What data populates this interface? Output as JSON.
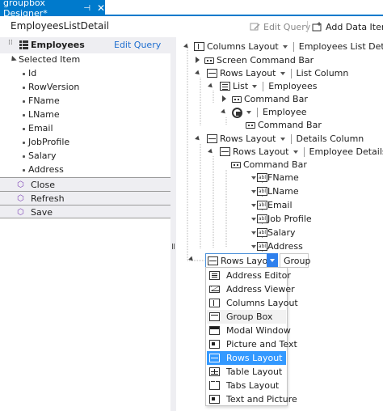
{
  "tab": {
    "title": "groupbox Designer*",
    "pin": "⊣",
    "close": "✕"
  },
  "toolbar": {
    "screen_name": "EmployeesListDetail",
    "edit_query": "Edit Query",
    "add_data_item": "Add Data Item..."
  },
  "left_panel": {
    "entity": "Employees",
    "edit_query": "Edit Query",
    "selected_item": "Selected Item",
    "fields": [
      "Id",
      "RowVersion",
      "FName",
      "LName",
      "Email",
      "JobProfile",
      "Salary",
      "Address"
    ],
    "commands": [
      "Close",
      "Refresh",
      "Save"
    ]
  },
  "tree": {
    "root": {
      "control": "Columns Layout",
      "name": "Employees List Detail"
    },
    "screen_command_bar": "Screen Command Bar",
    "rows1": {
      "control": "Rows Layout",
      "name": "List Column"
    },
    "list": {
      "control": "List",
      "name": "Employees"
    },
    "list_command_bar": "Command Bar",
    "employee": "Employee",
    "employee_command_bar": "Command Bar",
    "rows2": {
      "control": "Rows Layout",
      "name": "Details Column"
    },
    "rows3": {
      "control": "Rows Layout",
      "name": "Employee Details"
    },
    "details_command_bar": "Command Bar",
    "detail_fields": [
      "FName",
      "LName",
      "Email",
      "Job Profile",
      "Salary",
      "Address"
    ],
    "new_group": {
      "control": "Rows Layout",
      "name": "Group"
    }
  },
  "menu": {
    "items": [
      "Address Editor",
      "Address Viewer",
      "Columns Layout",
      "Group Box",
      "Modal Window",
      "Picture and Text",
      "Rows Layout",
      "Table Layout",
      "Tabs Layout",
      "Text and Picture"
    ],
    "selected": "Rows Layout",
    "hovered": "Group Box"
  },
  "colors": {
    "accent": "#007acc",
    "selection": "#3399ff",
    "link": "#1e6ecf"
  }
}
